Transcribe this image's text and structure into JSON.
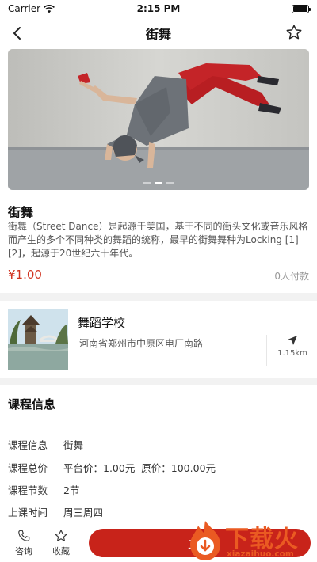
{
  "status_bar": {
    "carrier": "Carrier",
    "time": "2:15 PM"
  },
  "nav": {
    "title": "街舞"
  },
  "course": {
    "title": "街舞",
    "description": "街舞（Street Dance）是起源于美国，基于不同的街头文化或音乐风格而产生的多个不同种类的舞蹈的统称，最早的街舞舞种为Locking [1][2]，起源于20世纪六十年代。",
    "price": "¥1.00",
    "paid_count": "0人付款",
    "carousel": {
      "pages": 3,
      "active": 1
    }
  },
  "school": {
    "name": "舞蹈学校",
    "address": "河南省郑州市中原区电厂南路",
    "distance": "1.15km"
  },
  "course_info": {
    "title": "课程信息",
    "rows": [
      {
        "label": "课程信息",
        "value": "街舞"
      },
      {
        "label": "课程总价",
        "value": "平台价：1.00元  原价：100.00元"
      },
      {
        "label": "课程节数",
        "value": "2节"
      },
      {
        "label": "上课时间",
        "value": "周三周四"
      }
    ]
  },
  "bottom_bar": {
    "consult_label": "咨询",
    "favorite_label": "收藏",
    "enroll_label": "立即"
  },
  "watermark": {
    "text": "下载火",
    "url": "xiazaihuo.com"
  },
  "colors": {
    "accent": "#c8231a",
    "price": "#d0321f",
    "watermark": "#ea5a22"
  }
}
